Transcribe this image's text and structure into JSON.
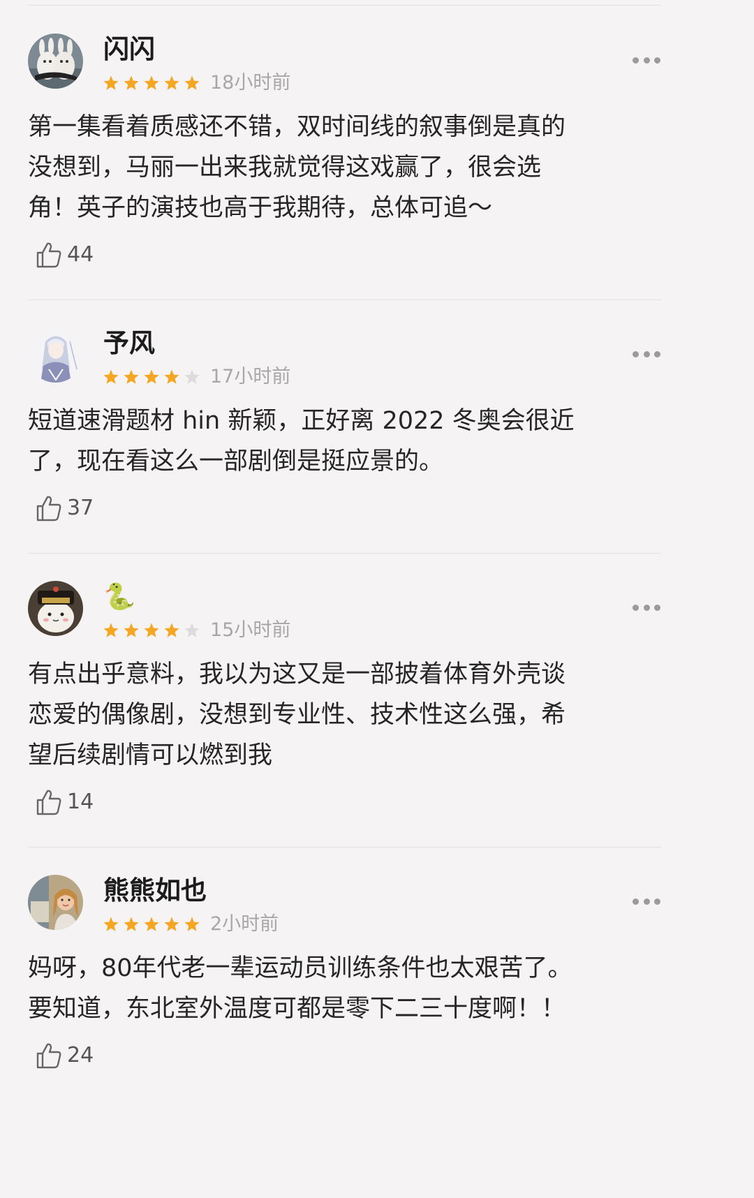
{
  "reviews": [
    {
      "username": "闪闪",
      "stars": 5,
      "time": "18小时前",
      "content_lines": [
        "第一集看着质感还不错，双时间线的叙事倒是真的",
        "没想到，马丽一出来我就觉得这戏赢了，很会选",
        "角！英子的演技也高于我期待，总体可追～"
      ],
      "likes": "44",
      "avatar_icon": "white-rabbits-avatar"
    },
    {
      "username": "予风",
      "stars": 4,
      "time": "17小时前",
      "content_lines": [
        "短道速滑题材 hin 新颖，正好离 2022 冬奥会很近",
        "了，现在看这么一部剧倒是挺应景的。"
      ],
      "likes": "37",
      "avatar_icon": "anime-character-avatar"
    },
    {
      "username": "🐍",
      "stars": 4,
      "time": "15小时前",
      "content_lines": [
        "有点出乎意料，我以为这又是一部披着体育外壳谈",
        "恋爱的偶像剧，没想到专业性、技术性这么强，希",
        "望后续剧情可以燃到我"
      ],
      "likes": "14",
      "avatar_icon": "cat-official-hat-avatar"
    },
    {
      "username": "熊熊如也",
      "stars": 5,
      "time": "2小时前",
      "content_lines": [
        "妈呀，80年代老一辈运动员训练条件也太艰苦了。",
        "要知道，东北室外温度可都是零下二三十度啊！！"
      ],
      "likes": "24",
      "avatar_icon": "photo-avatar"
    }
  ],
  "colors": {
    "star_filled": "#f5a623",
    "star_empty": "#dcdcdc",
    "time": "#a7a7a7",
    "background": "#f5f3f3",
    "divider": "#e4e1e1"
  },
  "icons": {
    "like": "thumbs-up-icon",
    "more": "more-dots-icon",
    "star": "star-icon"
  }
}
